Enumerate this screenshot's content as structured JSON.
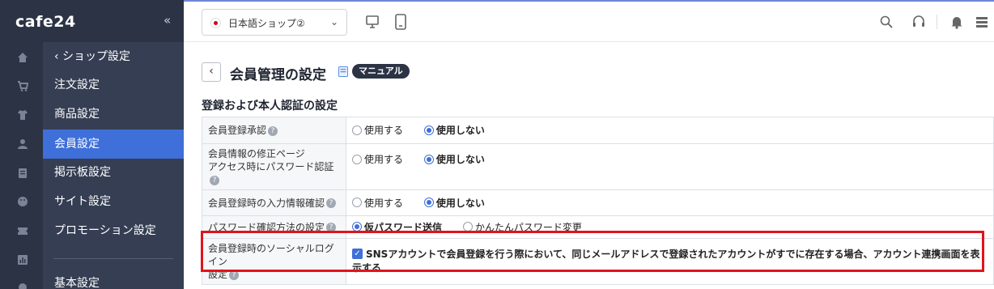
{
  "brand": {
    "logo": "cafe24",
    "collapse_icon": "double-chevron-left-icon"
  },
  "sidebar": {
    "rail_icons": [
      "home-icon",
      "cart-icon",
      "shirt-icon",
      "user-icon",
      "board-icon",
      "palette-icon",
      "ticket-icon",
      "chart-icon",
      "gear-icon"
    ],
    "items": [
      {
        "label": "‹ ショップ設定"
      },
      {
        "label": "注文設定"
      },
      {
        "label": "商品設定"
      },
      {
        "label": "会員設定",
        "active": true
      },
      {
        "label": "掲示板設定"
      },
      {
        "label": "サイト設定"
      },
      {
        "label": "プロモーション設定"
      },
      {
        "label": "基本設定"
      }
    ]
  },
  "topbar": {
    "shop_select": {
      "value": "日本語ショップ②",
      "flag": "japan-flag-icon"
    },
    "icons": [
      "monitor-icon",
      "tablet-icon",
      "search-icon",
      "headset-icon",
      "bell-icon",
      "menu-icon"
    ]
  },
  "page": {
    "title": "会員管理の設定",
    "manual_badge": "マニュアル",
    "section_title": "登録および本人認証の設定"
  },
  "settings": {
    "row1": {
      "label": "会員登録承認",
      "opt1": "使用する",
      "opt2": "使用しない",
      "selected": 2
    },
    "row2": {
      "label_line1": "会員情報の修正ページ",
      "label_line2": "アクセス時にパスワード認証",
      "opt1": "使用する",
      "opt2": "使用しない",
      "selected": 2
    },
    "row3": {
      "label": "会員登録時の入力情報確認",
      "opt1": "使用する",
      "opt2": "使用しない",
      "selected": 2
    },
    "row4": {
      "label": "パスワード確認方法の設定",
      "opt1": "仮パスワード送信",
      "opt2": "かんたんパスワード変更",
      "selected": 1
    },
    "row5": {
      "label_line1": "会員登録時のソーシャルログイン",
      "label_line2": "設定",
      "checkbox_text": "SNSアカウントで会員登録を行う際において、同じメールアドレスで登録されたアカウントがすでに存在する場合、アカウント連携画面を表示する",
      "checked": true
    }
  },
  "colors": {
    "sidebar": "#2b3344",
    "menu_panel": "#353e53",
    "active": "#3f6fd8",
    "highlight": "#e1141c"
  }
}
